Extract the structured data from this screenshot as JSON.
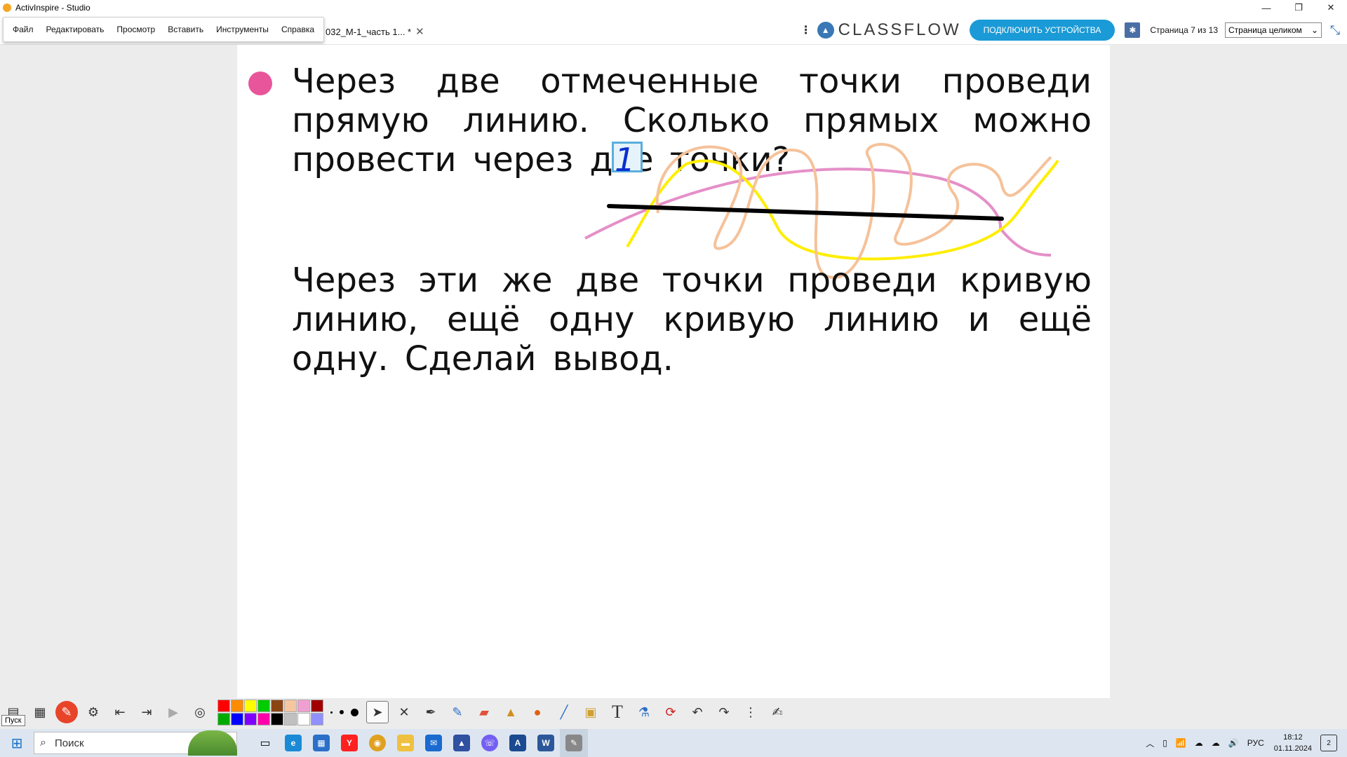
{
  "window": {
    "title": "ActivInspire - Studio",
    "minimize": "—",
    "restore": "❐",
    "close": "✕"
  },
  "menu": {
    "items": [
      "Файл",
      "Редактировать",
      "Просмотр",
      "Вставить",
      "Инструменты",
      "Справка"
    ]
  },
  "doc_tab": {
    "label": "032_М-1_часть 1... *",
    "close": "✕"
  },
  "classflow": {
    "logo": "CLASSFLOW",
    "connect_label": "ПОДКЛЮЧИТЬ УСТРОЙСТВА"
  },
  "page_nav": {
    "count": "Страница 7 из 13",
    "zoom_value": "Страница целиком"
  },
  "content": {
    "para1": "Через две отмеченные точки проведи прямую линию. Сколько прямых можно провести через две точки?",
    "answer": "1",
    "para2": "Через эти же две точки проведи кривую линию, ещё одну кривую линию и ещё одну. Сделай вывод."
  },
  "colors": {
    "bullet": "#e8559a",
    "swatches": [
      "#ff0000",
      "#ff8c00",
      "#ffff00",
      "#00cc00",
      "#8b4513",
      "#f5c6a0",
      "#f0a0d0",
      "#a00000",
      "#00aa00",
      "#0000ff",
      "#8000ff",
      "#ff00aa",
      "#000000",
      "#c0c0c0",
      "#ffffff",
      "#9090ff"
    ],
    "ink_line": "#000000",
    "ink_yellow": "#ffee00",
    "ink_peach": "#f5c29a",
    "ink_pink": "#e58fc8",
    "ink_answer": "#0a2fd0"
  },
  "tooltip": "Пуск",
  "taskbar": {
    "search_placeholder": "Поиск",
    "lang": "РУС",
    "time": "18:12",
    "date": "01.11.2024",
    "notifications": "2"
  }
}
